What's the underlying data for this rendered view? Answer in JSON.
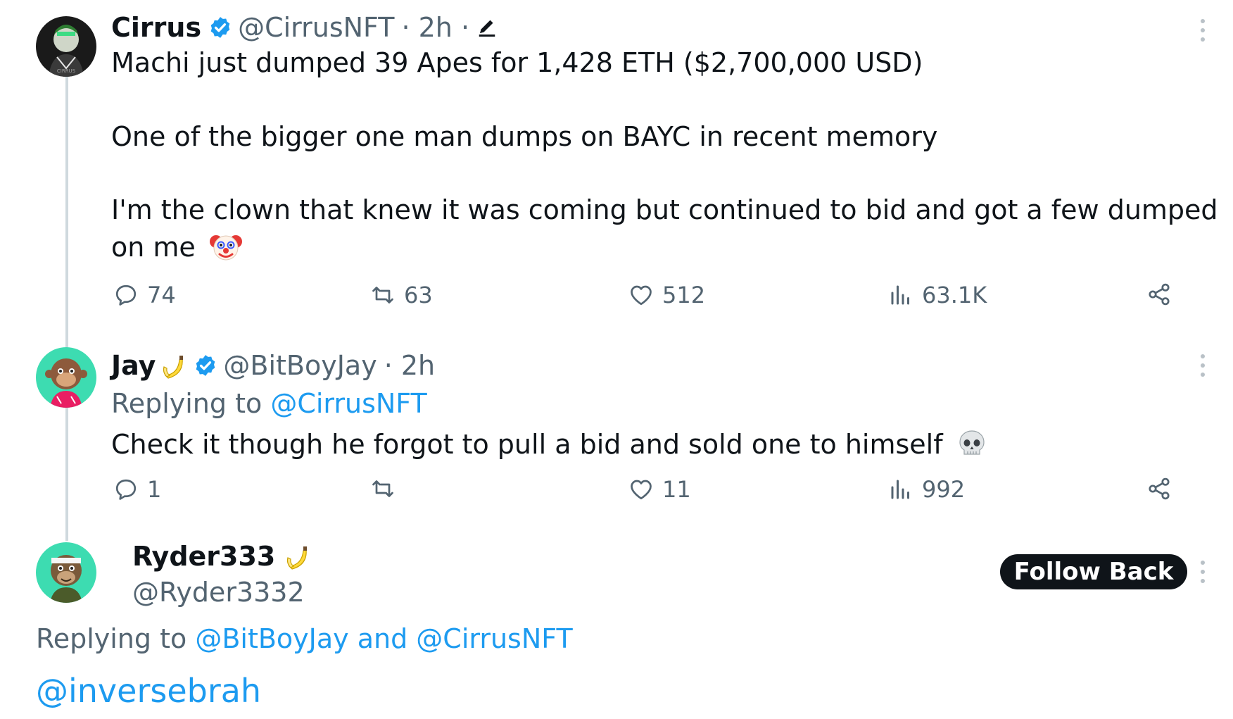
{
  "tweets": [
    {
      "name": "Cirrus",
      "handle": "@CirrusNFT",
      "time": "· 2h ·",
      "lines": [
        "Machi just dumped 39 Apes for 1,428 ETH ($2,700,000 USD)",
        "One of the bigger one man dumps on BAYC in recent memory",
        "I'm the clown that knew it was coming but continued to bid and got a few dumped",
        "on me"
      ],
      "emoji": "clown-face",
      "replies": "74",
      "retweets": "63",
      "likes": "512",
      "views": "63.1K"
    },
    {
      "name": "Jay",
      "handle": "@BitBoyJay",
      "time": "· 2h",
      "replying_prefix": "Replying to",
      "replying_to": "@CirrusNFT",
      "text": "Check it though he forgot to pull a bid and sold one to himself",
      "emoji": "skull",
      "replies": "1",
      "retweets": "",
      "likes": "11",
      "views": "992"
    },
    {
      "name": "Ryder333",
      "handle": "@Ryder3332",
      "follow_label": "Follow Back",
      "replying_prefix": "Replying to",
      "replying_to": "@BitBoyJay and @CirrusNFT",
      "text": "@inversebrah"
    }
  ],
  "icons": [
    "verified-badge-icon",
    "edit-pencil-icon",
    "reply-icon",
    "retweet-icon",
    "like-icon",
    "views-icon",
    "share-icon",
    "more-icon",
    "banana-icon"
  ],
  "colors": {
    "link": "#1d9bf0",
    "muted": "#536471",
    "verified": "#1d9bf0",
    "thread_line": "#cfd9de",
    "button": "#0f1419"
  }
}
